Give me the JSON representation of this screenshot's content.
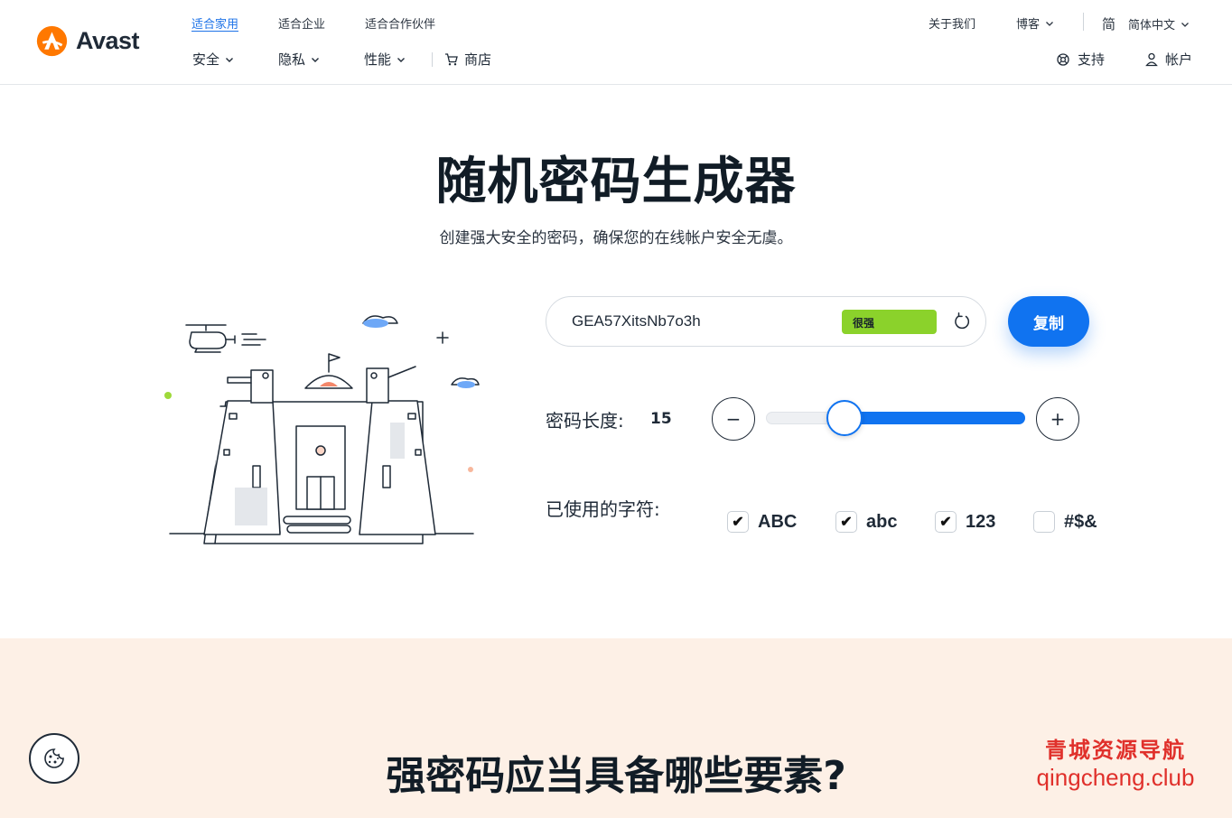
{
  "brand": {
    "name": "Avast"
  },
  "header": {
    "segments": [
      "适合家用",
      "适合企业",
      "适合合作伙伴"
    ],
    "nav": [
      {
        "label": "安全"
      },
      {
        "label": "隐私"
      },
      {
        "label": "性能"
      },
      {
        "label": "商店"
      }
    ],
    "about": "关于我们",
    "blog": "博客",
    "lang_icon": "简",
    "language": "简体中文",
    "support": "支持",
    "account": "帐户"
  },
  "hero": {
    "title": "随机密码生成器",
    "subtitle": "创建强大安全的密码，确保您的在线帐户安全无虞。"
  },
  "generator": {
    "password": "GEA57XitsNb7o3h",
    "strength": "很强",
    "copy_label": "复制",
    "length_label": "密码长度:",
    "length_value": "15",
    "length_fraction": 0.3,
    "minus": "−",
    "plus": "+",
    "chars_label": "已使用的字符:",
    "options": [
      {
        "label": "ABC",
        "checked": true
      },
      {
        "label": "abc",
        "checked": true
      },
      {
        "label": "123",
        "checked": true
      },
      {
        "label": "#$&",
        "checked": false
      }
    ]
  },
  "section2": {
    "title": "强密码应当具备哪些要素?"
  },
  "watermark": {
    "line1": "青城资源导航",
    "line2": "qingcheng.club"
  },
  "colors": {
    "accent": "#1073f0",
    "strength_green": "#8bd22b",
    "brand_orange": "#ff7800",
    "bottom_bg": "#fdf0e6"
  },
  "icons": [
    "avast-logo-icon",
    "chevron-down-icon",
    "cart-icon",
    "support-icon",
    "user-icon",
    "refresh-icon",
    "check-icon",
    "cookie-icon"
  ]
}
